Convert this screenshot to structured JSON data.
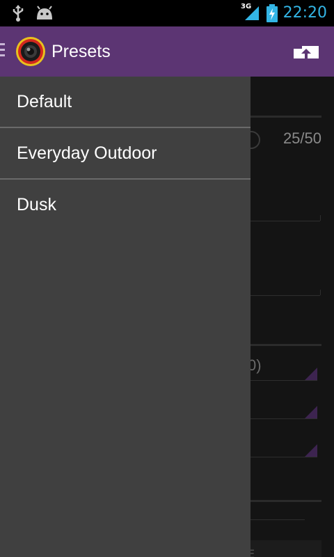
{
  "status_bar": {
    "time": "22:20",
    "network_type": "3G",
    "icons": [
      "usb-icon",
      "android-debug-icon",
      "signal-icon",
      "battery-charging-icon"
    ]
  },
  "action_bar": {
    "title": "Presets",
    "logo": "camera-lens-icon",
    "action_icon": "upload-icon",
    "background": "#5c3573"
  },
  "drawer": {
    "items": [
      {
        "label": "Default"
      },
      {
        "label": "Everyday Outdoor"
      },
      {
        "label": "Dusk"
      }
    ]
  },
  "background_content": {
    "counter": "25/50",
    "spinner_value_partial": "0)",
    "button_text_partial": "E"
  },
  "colors": {
    "accent": "#33b5e5",
    "drawer_bg": "#404040",
    "divider": "#6a6a6a"
  }
}
